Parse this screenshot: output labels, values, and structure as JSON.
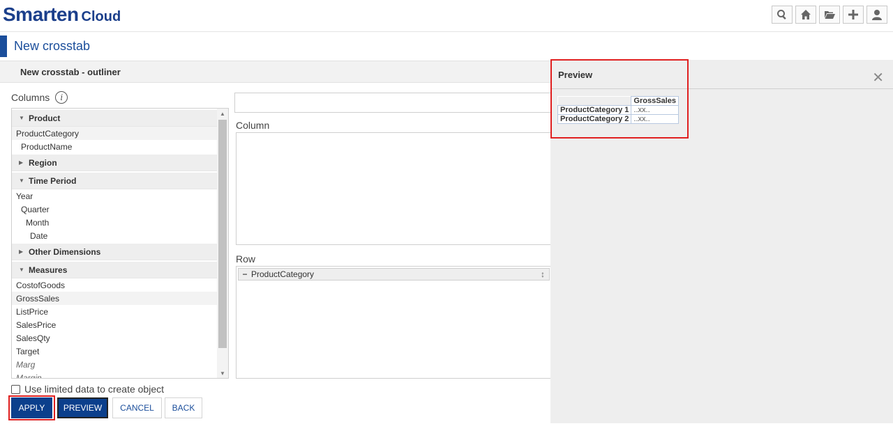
{
  "header": {
    "brand": "Smarten",
    "brand_sub": "Cloud",
    "icons": [
      "search-icon",
      "home-icon",
      "folder-open-icon",
      "plus-icon",
      "user-icon"
    ]
  },
  "page": {
    "title": "New crosstab"
  },
  "outliner": {
    "title": "New crosstab - outliner",
    "columns_label": "Columns",
    "groups": [
      {
        "name": "Product",
        "expanded": true,
        "items": [
          {
            "label": "ProductCategory",
            "indent": 0,
            "highlight": true
          },
          {
            "label": "ProductName",
            "indent": 1
          }
        ]
      },
      {
        "name": "Region",
        "expanded": false,
        "items": []
      },
      {
        "name": "Time Period",
        "expanded": true,
        "items": [
          {
            "label": "Year",
            "indent": 0
          },
          {
            "label": "Quarter",
            "indent": 1
          },
          {
            "label": "Month",
            "indent": 2
          },
          {
            "label": "Date",
            "indent": 3
          }
        ]
      },
      {
        "name": "Other Dimensions",
        "expanded": false,
        "items": []
      },
      {
        "name": "Measures",
        "expanded": true,
        "items": [
          {
            "label": "CostofGoods",
            "indent": 0
          },
          {
            "label": "GrossSales",
            "indent": 0,
            "highlight": true
          },
          {
            "label": "ListPrice",
            "indent": 0
          },
          {
            "label": "SalesPrice",
            "indent": 0
          },
          {
            "label": "SalesQty",
            "indent": 0
          },
          {
            "label": "Target",
            "indent": 0
          },
          {
            "label": "Marg",
            "indent": 0,
            "italic": true
          },
          {
            "label": "Margin",
            "indent": 0,
            "italic": true
          }
        ]
      }
    ],
    "name_input_value": "",
    "column_label": "Column",
    "row_label": "Row",
    "row_items": [
      "ProductCategory"
    ],
    "limited_data_label": "Use limited data to create object",
    "limited_data_checked": false
  },
  "buttons": {
    "apply": "APPLY",
    "preview": "PREVIEW",
    "cancel": "CANCEL",
    "back": "BACK"
  },
  "preview": {
    "title": "Preview",
    "column_header": "GrossSales",
    "rows": [
      {
        "label": "ProductCategory 1",
        "value": "..xx.."
      },
      {
        "label": "ProductCategory 2",
        "value": "..xx.."
      }
    ]
  },
  "colors": {
    "brand": "#1b3f8b",
    "accent": "#0b3f8c",
    "highlight_box": "#e02020"
  }
}
